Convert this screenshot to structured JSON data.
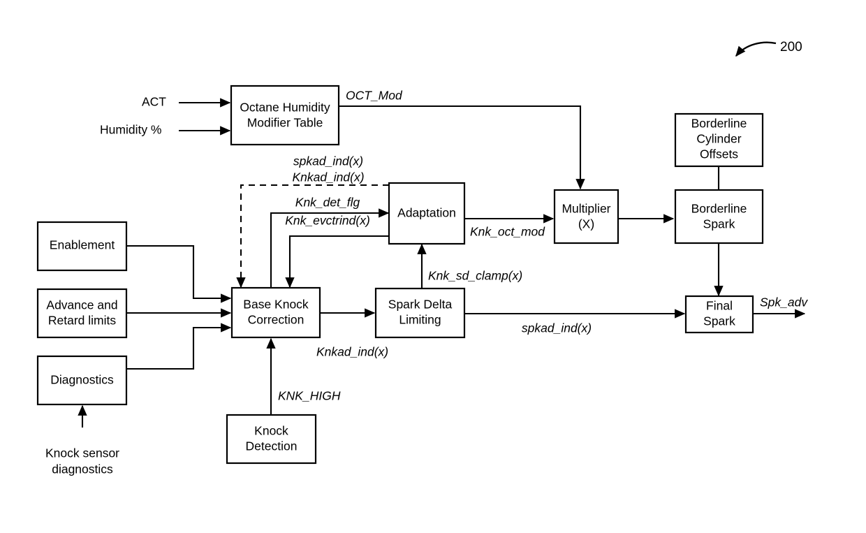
{
  "figure": {
    "reference_numeral": "200"
  },
  "inputs": [
    {
      "id": "act",
      "label": "ACT"
    },
    {
      "id": "humidity",
      "label": "Humidity %"
    },
    {
      "id": "knock-sensor-diagnostics",
      "label_line1": "Knock sensor",
      "label_line2": "diagnostics"
    }
  ],
  "blocks": [
    {
      "id": "octane-humidity-modifier-table",
      "line1": "Octane Humidity",
      "line2": "Modifier Table",
      "line3": ""
    },
    {
      "id": "enablement",
      "line1": "Enablement",
      "line2": "",
      "line3": ""
    },
    {
      "id": "advance-and-retard-limits",
      "line1": "Advance and",
      "line2": "Retard limits",
      "line3": ""
    },
    {
      "id": "diagnostics",
      "line1": "Diagnostics",
      "line2": "",
      "line3": ""
    },
    {
      "id": "base-knock-correction",
      "line1": "Base Knock",
      "line2": "Correction",
      "line3": ""
    },
    {
      "id": "knock-detection",
      "line1": "Knock",
      "line2": "Detection",
      "line3": ""
    },
    {
      "id": "adaptation",
      "line1": "Adaptation",
      "line2": "",
      "line3": ""
    },
    {
      "id": "spark-delta-limiting",
      "line1": "Spark Delta",
      "line2": "Limiting",
      "line3": ""
    },
    {
      "id": "multiplier",
      "line1": "Multiplier",
      "line2": "(X)",
      "line3": ""
    },
    {
      "id": "borderline-cylinder-offsets",
      "line1": "Borderline",
      "line2": "Cylinder",
      "line3": "Offsets"
    },
    {
      "id": "borderline-spark",
      "line1": "Borderline",
      "line2": "Spark",
      "line3": ""
    },
    {
      "id": "final-spark",
      "line1": "Final",
      "line2": "Spark",
      "line3": ""
    }
  ],
  "signals": [
    {
      "id": "oct-mod",
      "label": "OCT_Mod"
    },
    {
      "id": "spkad-ind-feedback",
      "label": "spkad_ind(x)"
    },
    {
      "id": "knkad-ind-feedback",
      "label": "Knkad_ind(x)"
    },
    {
      "id": "knk-det-flg",
      "label": "Knk_det_flg"
    },
    {
      "id": "knk-evctrind",
      "label": "Knk_evctrind(x)"
    },
    {
      "id": "knk-oct-mod",
      "label": "Knk_oct_mod"
    },
    {
      "id": "knk-sd-clamp",
      "label": "Knk_sd_clamp(x)"
    },
    {
      "id": "knkad-ind-out",
      "label": "Knkad_ind(x)"
    },
    {
      "id": "knk-high",
      "label": "KNK_HIGH"
    },
    {
      "id": "spkad-ind-out",
      "label": "spkad_ind(x)"
    },
    {
      "id": "spk-adv",
      "label": "Spk_adv"
    }
  ],
  "colors": {
    "stroke": "#000000",
    "background": "#ffffff"
  }
}
